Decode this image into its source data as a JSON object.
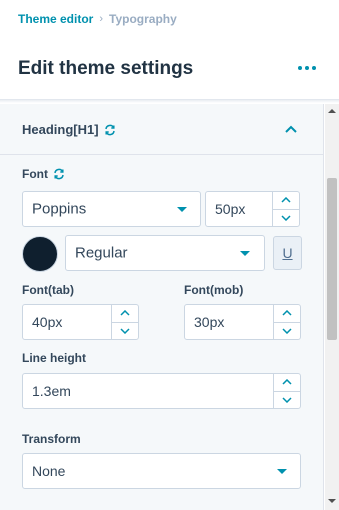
{
  "breadcrumb": {
    "parent": "Theme editor",
    "separator": "›",
    "current": "Typography"
  },
  "header": {
    "title": "Edit theme settings",
    "more_icon": "more-horizontal-icon"
  },
  "section": {
    "title": "Heading[H1]",
    "sync_icon": "sync-icon",
    "expanded": true
  },
  "font": {
    "label": "Font",
    "family": "Poppins",
    "size": "50px",
    "color": "#0f1f2e",
    "weight": "Regular",
    "underline_label": "U"
  },
  "font_tab": {
    "label": "Font(tab)",
    "value": "40px"
  },
  "font_mob": {
    "label": "Font(mob)",
    "value": "30px"
  },
  "line_height": {
    "label": "Line height",
    "value": "1.3em"
  },
  "transform": {
    "label": "Transform",
    "value": "None"
  },
  "colors": {
    "accent": "#0091ae",
    "text": "#33475b",
    "panel_bg": "#f5f8fa",
    "border": "#cbd6e2"
  }
}
